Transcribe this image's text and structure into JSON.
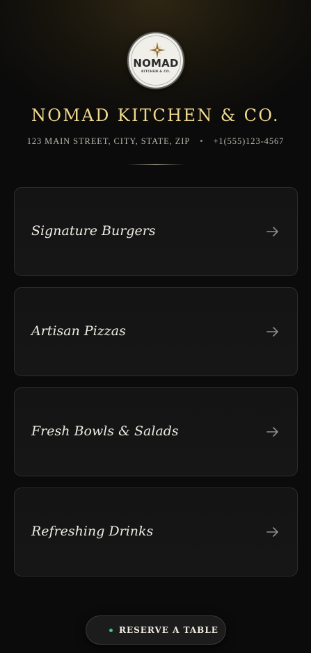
{
  "brand": {
    "logo_name": "NOMAD",
    "logo_sub": "KITCHEN & CO.",
    "title": "NOMAD KITCHEN & CO."
  },
  "contact": {
    "address": "123 MAIN STREET, CITY, STATE, ZIP",
    "separator": "•",
    "phone": "+1(555)123-4567"
  },
  "menu": {
    "items": [
      {
        "label": "Signature Burgers",
        "icon": "arrow-right-icon"
      },
      {
        "label": "Artisan Pizzas",
        "icon": "arrow-right-icon"
      },
      {
        "label": "Fresh Bowls & Salads",
        "icon": "arrow-right-icon"
      },
      {
        "label": "Refreshing Drinks",
        "icon": "arrow-right-icon"
      }
    ]
  },
  "reserve": {
    "label": "RESERVE A TABLE",
    "status_color": "#3ec98a"
  },
  "colors": {
    "accent_gold": "#f1d98f",
    "background": "#0b0b0b",
    "card": "#141414"
  }
}
